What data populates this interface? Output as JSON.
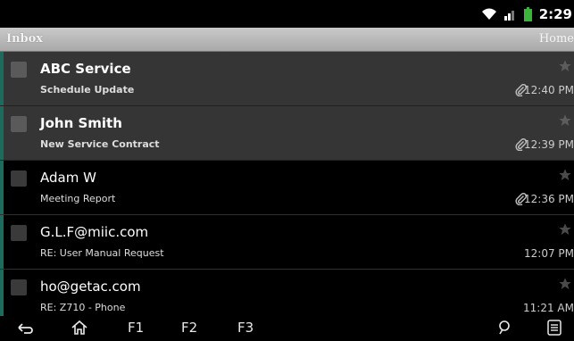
{
  "status_bar": {
    "time": "2:29",
    "icons": [
      "wifi-icon",
      "signal-icon",
      "battery-icon"
    ]
  },
  "title_bar": {
    "title": "Inbox",
    "right_label": "Home"
  },
  "messages": [
    {
      "sender": "ABC Service",
      "subject": "Schedule Update",
      "time": "12:40 PM",
      "attachment": true,
      "unread": true
    },
    {
      "sender": "John Smith",
      "subject": "New Service Contract",
      "time": "12:39 PM",
      "attachment": true,
      "unread": true
    },
    {
      "sender": "Adam W",
      "subject": "Meeting Report",
      "time": "12:36 PM",
      "attachment": true,
      "unread": false
    },
    {
      "sender": "G.L.F@miic.com",
      "subject": "RE: User Manual Request",
      "time": "12:07 PM",
      "attachment": false,
      "unread": false
    },
    {
      "sender": "ho@getac.com",
      "subject": "RE: Z710 - Phone",
      "time": "11:21 AM",
      "attachment": false,
      "unread": false
    }
  ],
  "nav_bar": {
    "f1": "F1",
    "f2": "F2",
    "f3": "F3"
  },
  "colors": {
    "accent_edge": "#1e6a5d",
    "unread_bg": "#353535",
    "title_bar": "#b8b8b8",
    "battery": "#3cb43c"
  }
}
